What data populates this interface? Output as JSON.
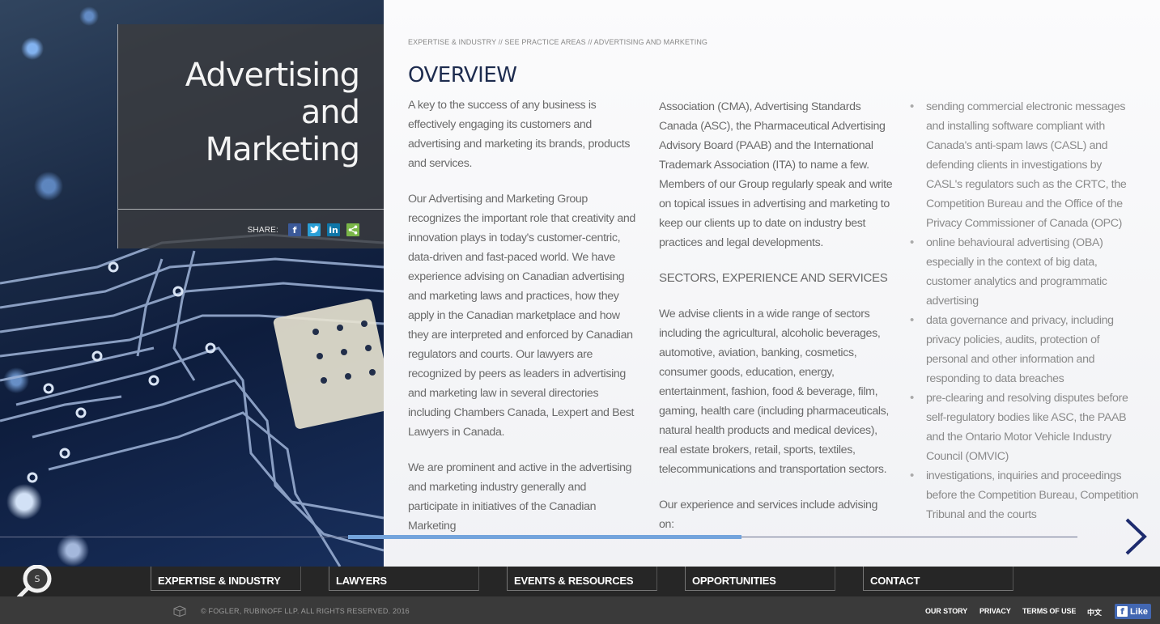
{
  "hero": {
    "title_line1": "Advertising and",
    "title_line2": "Marketing",
    "share_label": "SHARE:",
    "share_icons": [
      "facebook-icon",
      "twitter-icon",
      "linkedin-icon",
      "share-icon"
    ]
  },
  "breadcrumb": "EXPERTISE & INDUSTRY // SEE PRACTICE AREAS // ADVERTISING AND MARKETING",
  "overview_heading": "OVERVIEW",
  "col1": {
    "p1": "A key to the success of any business is effectively engaging its customers and advertising and marketing its brands, products and services.",
    "p2": "Our Advertising and Marketing Group recognizes the important role that creativity and innovation plays in today's customer-centric, data-driven and fast-paced world.  We have experience advising on Canadian advertising and marketing laws and practices, how they apply in the Canadian marketplace and how they are interpreted and enforced by Canadian regulators and courts.  Our lawyers are recognized by peers as leaders in advertising and marketing law in several directories including Chambers Canada, Lexpert and Best Lawyers in Canada.",
    "p3": "We are prominent and active in the advertising and marketing industry generally and participate in initiatives of the Canadian Marketing"
  },
  "col2": {
    "p1": "Association (CMA), Advertising Standards Canada (ASC), the Pharmaceutical Advertising Advisory Board (PAAB) and the International Trademark Association (ITA) to name a few.  Members of our Group regularly speak and write on topical issues in advertising and marketing to keep our clients up to date on industry best practices and legal developments.",
    "heading": "SECTORS, EXPERIENCE AND SERVICES",
    "p2": "We advise clients in a wide range of sectors including the agricultural, alcoholic beverages, automotive, aviation, banking, cosmetics, consumer goods, education, energy, entertainment, fashion, food & beverage, film, gaming, health care (including pharmaceuticals, natural health products and medical devices), real estate brokers, retail, sports, textiles, telecommunications and transportation sectors.",
    "p3": "Our experience and services include advising on:"
  },
  "col3": {
    "items": [
      "sending commercial electronic messages and installing software compliant with Canada's anti-spam laws (CASL) and defending clients in investigations by CASL's regulators such as the CRTC, the Competition Bureau and the Office of the Privacy Commissioner of Canada (OPC)",
      "online behavioural advertising (OBA) especially in the context of big data, customer analytics and programmatic advertising",
      "data governance and privacy, including privacy policies, audits, protection of personal and other information and responding to data breaches",
      "pre-clearing and resolving disputes before self-regulatory bodies like ASC, the PAAB and the Ontario Motor Vehicle Industry Council (OMVIC)",
      "investigations, inquiries and proceedings before the Competition Bureau, Competition Tribunal and the courts"
    ]
  },
  "progress": {
    "fraction_start": 0.323,
    "fraction_end": 0.688
  },
  "nav": {
    "items": [
      "EXPERTISE & INDUSTRY",
      "LAWYERS",
      "EVENTS & RESOURCES",
      "OPPORTUNITIES",
      "CONTACT"
    ],
    "search_letter": "S"
  },
  "footer": {
    "copyright": "© FOGLER, RUBINOFF LLP. ALL RIGHTS RESERVED. 2016",
    "links": [
      "OUR STORY",
      "PRIVACY",
      "TERMS OF USE",
      "中文"
    ],
    "like_label": "Like"
  },
  "colors": {
    "heading": "#1d2b4e",
    "accent": "#74a4dc",
    "navbar": "#262626",
    "footer": "#3a3a3a",
    "facebook": "#3b5998",
    "twitter": "#2a9fd6",
    "linkedin": "#0e76a8",
    "share": "#7ab648"
  }
}
